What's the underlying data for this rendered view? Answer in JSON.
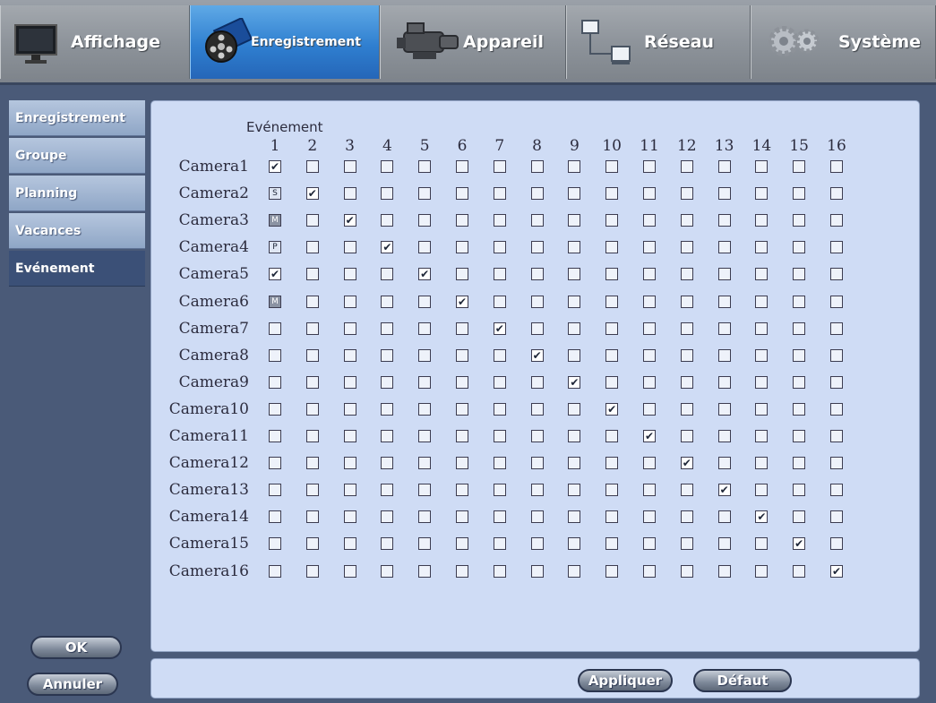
{
  "tabs": [
    {
      "label": "Affichage",
      "icon": "monitor-icon",
      "active": false
    },
    {
      "label": "Enregistrement",
      "icon": "film-reel-icon",
      "active": true
    },
    {
      "label": "Appareil",
      "icon": "camcorder-icon",
      "active": false
    },
    {
      "label": "Réseau",
      "icon": "network-icon",
      "active": false
    },
    {
      "label": "Système",
      "icon": "gears-icon",
      "active": false
    }
  ],
  "sidebar": {
    "items": [
      {
        "label": "Enregistrement",
        "active": false
      },
      {
        "label": "Groupe",
        "active": false
      },
      {
        "label": "Planning",
        "active": false
      },
      {
        "label": "Vacances",
        "active": false
      },
      {
        "label": "Evénement",
        "active": true
      }
    ],
    "ok_label": "OK",
    "cancel_label": "Annuler"
  },
  "grid": {
    "title": "Evénement",
    "columns": [
      "1",
      "2",
      "3",
      "4",
      "5",
      "6",
      "7",
      "8",
      "9",
      "10",
      "11",
      "12",
      "13",
      "14",
      "15",
      "16"
    ],
    "rows": [
      {
        "label": "Camera1",
        "cells": [
          "✔",
          "",
          "",
          "",
          "",
          "",
          "",
          "",
          "",
          "",
          "",
          "",
          "",
          "",
          "",
          ""
        ]
      },
      {
        "label": "Camera2",
        "cells": [
          "S",
          "✔",
          "",
          "",
          "",
          "",
          "",
          "",
          "",
          "",
          "",
          "",
          "",
          "",
          "",
          ""
        ]
      },
      {
        "label": "Camera3",
        "cells": [
          "M",
          "",
          "✔",
          "",
          "",
          "",
          "",
          "",
          "",
          "",
          "",
          "",
          "",
          "",
          "",
          ""
        ]
      },
      {
        "label": "Camera4",
        "cells": [
          "P",
          "",
          "",
          "✔",
          "",
          "",
          "",
          "",
          "",
          "",
          "",
          "",
          "",
          "",
          "",
          ""
        ]
      },
      {
        "label": "Camera5",
        "cells": [
          "✔",
          "",
          "",
          "",
          "✔",
          "",
          "",
          "",
          "",
          "",
          "",
          "",
          "",
          "",
          "",
          ""
        ]
      },
      {
        "label": "Camera6",
        "cells": [
          "M",
          "",
          "",
          "",
          "",
          "✔",
          "",
          "",
          "",
          "",
          "",
          "",
          "",
          "",
          "",
          ""
        ]
      },
      {
        "label": "Camera7",
        "cells": [
          "",
          "",
          "",
          "",
          "",
          "",
          "✔",
          "",
          "",
          "",
          "",
          "",
          "",
          "",
          "",
          ""
        ]
      },
      {
        "label": "Camera8",
        "cells": [
          "",
          "",
          "",
          "",
          "",
          "",
          "",
          "✔",
          "",
          "",
          "",
          "",
          "",
          "",
          "",
          ""
        ]
      },
      {
        "label": "Camera9",
        "cells": [
          "",
          "",
          "",
          "",
          "",
          "",
          "",
          "",
          "✔",
          "",
          "",
          "",
          "",
          "",
          "",
          ""
        ]
      },
      {
        "label": "Camera10",
        "cells": [
          "",
          "",
          "",
          "",
          "",
          "",
          "",
          "",
          "",
          "✔",
          "",
          "",
          "",
          "",
          "",
          ""
        ]
      },
      {
        "label": "Camera11",
        "cells": [
          "",
          "",
          "",
          "",
          "",
          "",
          "",
          "",
          "",
          "",
          "✔",
          "",
          "",
          "",
          "",
          ""
        ]
      },
      {
        "label": "Camera12",
        "cells": [
          "",
          "",
          "",
          "",
          "",
          "",
          "",
          "",
          "",
          "",
          "",
          "✔",
          "",
          "",
          "",
          ""
        ]
      },
      {
        "label": "Camera13",
        "cells": [
          "",
          "",
          "",
          "",
          "",
          "",
          "",
          "",
          "",
          "",
          "",
          "",
          "✔",
          "",
          "",
          ""
        ]
      },
      {
        "label": "Camera14",
        "cells": [
          "",
          "",
          "",
          "",
          "",
          "",
          "",
          "",
          "",
          "",
          "",
          "",
          "",
          "✔",
          "",
          ""
        ]
      },
      {
        "label": "Camera15",
        "cells": [
          "",
          "",
          "",
          "",
          "",
          "",
          "",
          "",
          "",
          "",
          "",
          "",
          "",
          "",
          "✔",
          ""
        ]
      },
      {
        "label": "Camera16",
        "cells": [
          "",
          "",
          "",
          "",
          "",
          "",
          "",
          "",
          "",
          "",
          "",
          "",
          "",
          "",
          "",
          "✔"
        ]
      }
    ]
  },
  "footer": {
    "apply_label": "Appliquer",
    "default_label": "Défaut"
  }
}
